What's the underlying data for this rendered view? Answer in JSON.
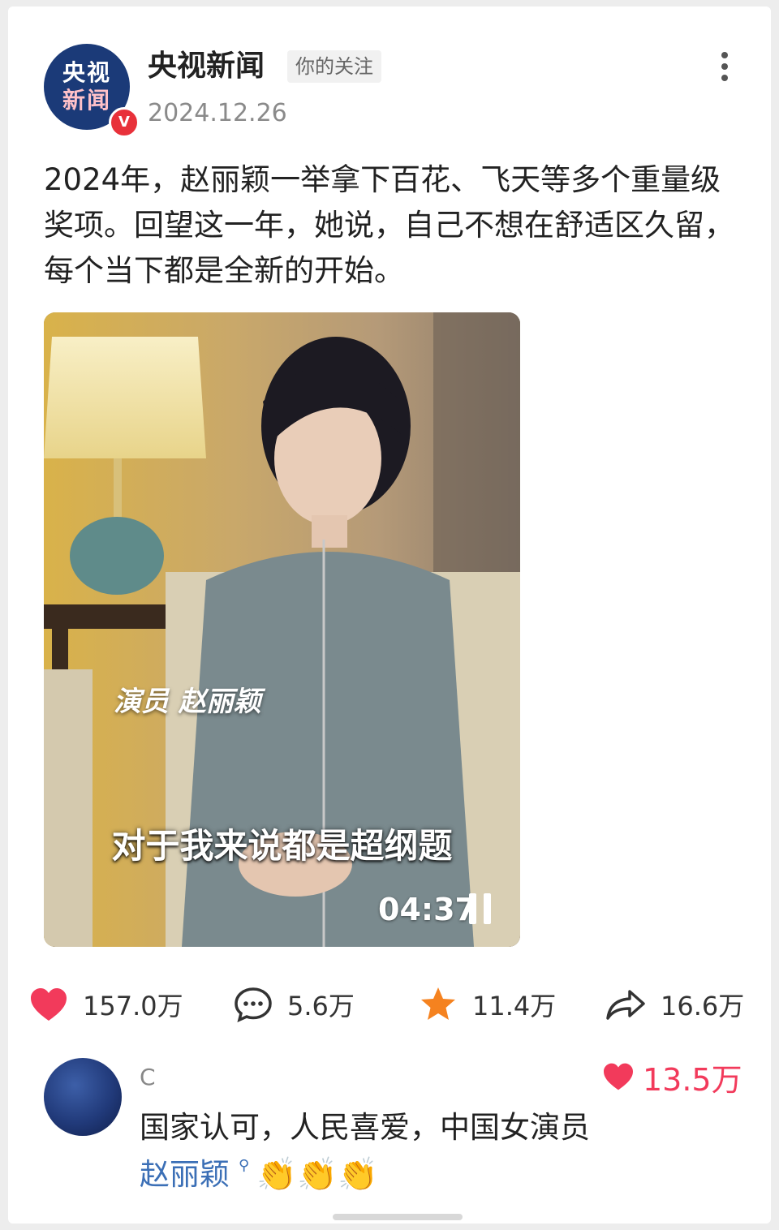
{
  "post": {
    "account": {
      "name": "央视新闻",
      "logo_line1": "央视",
      "logo_line2": "新闻",
      "verified_mark": "V"
    },
    "follow_badge": "你的关注",
    "date": "2024.12.26",
    "text": "2024年，赵丽颖一举拿下百花、飞天等多个重量级奖项。回望这一年，她说，自己不想在舒适区久留，每个当下都是全新的开始。",
    "video": {
      "caption_name": "演员 赵丽颖",
      "subtitle": "对于我来说都是超纲题",
      "duration": "04:37",
      "state": "paused"
    }
  },
  "actions": {
    "like": {
      "icon": "heart-icon",
      "count": "157.0万",
      "color": "#f23a5b"
    },
    "comment": {
      "icon": "comment-bubble-icon",
      "count": "5.6万"
    },
    "favorite": {
      "icon": "star-icon",
      "count": "11.4万",
      "color": "#f5821f"
    },
    "share": {
      "icon": "share-arrow-icon",
      "count": "16.6万"
    }
  },
  "top_comment": {
    "user": "C",
    "likes": "13.5万",
    "text": "国家认可，人民喜爱，中国女演员",
    "link": "赵丽颖",
    "emojis": [
      "👏",
      "👏",
      "👏"
    ],
    "link_color": "#3b6fb6"
  }
}
